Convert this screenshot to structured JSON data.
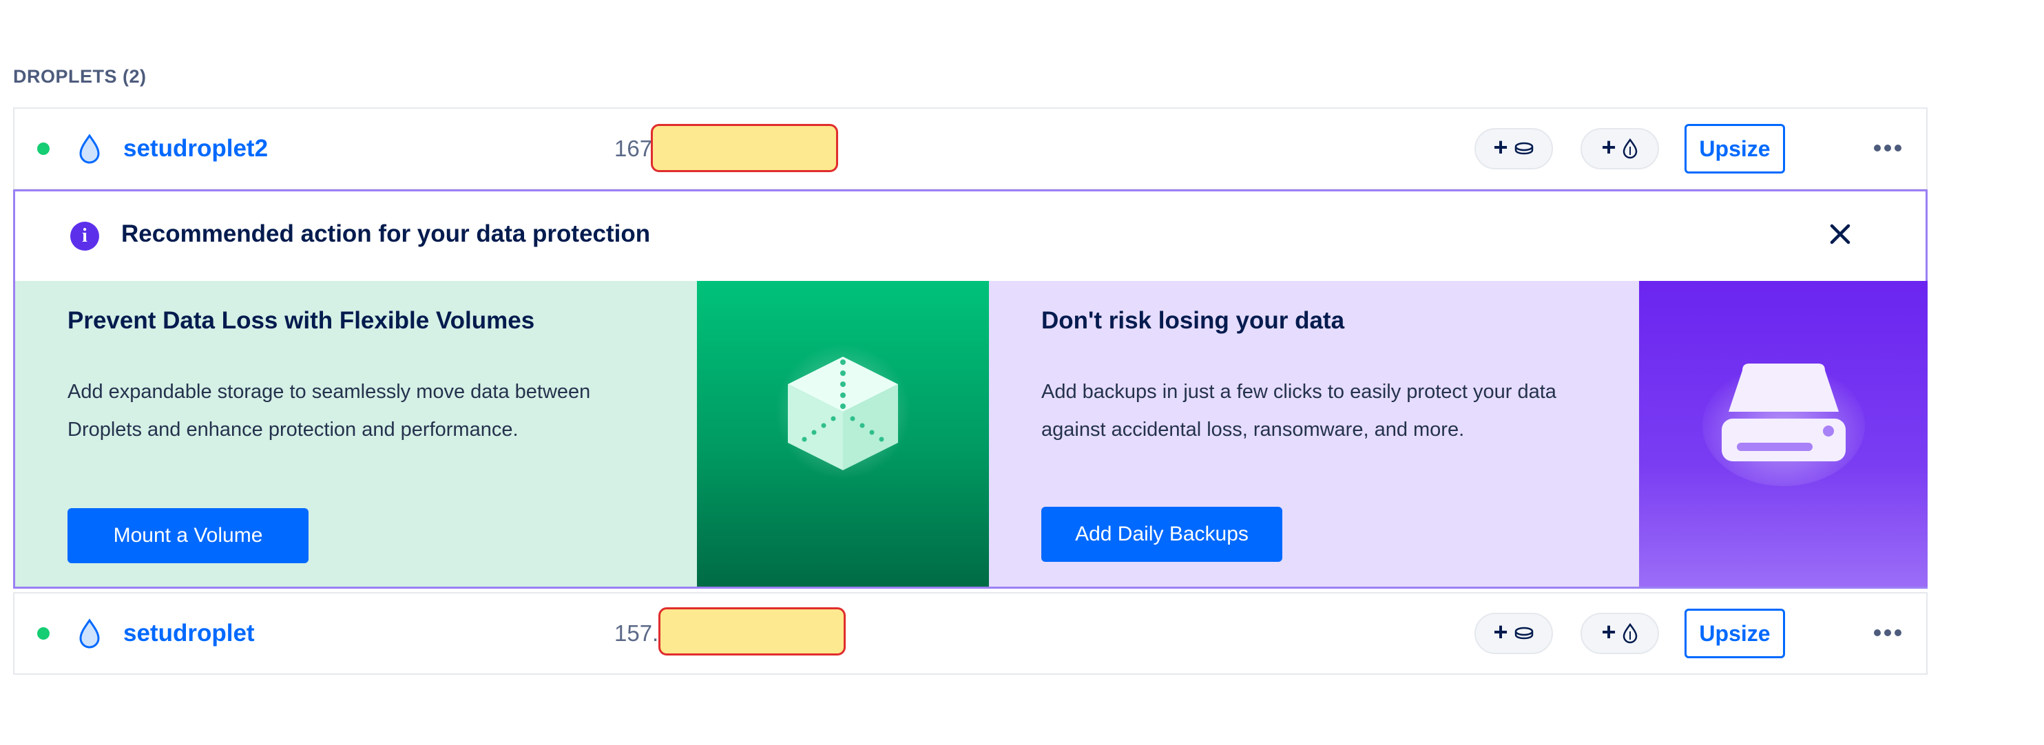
{
  "section": {
    "title": "DROPLETS (2)"
  },
  "droplets": [
    {
      "name": "setudroplet2",
      "ip": "167",
      "upsize_label": "Upsize",
      "status": "active"
    },
    {
      "name": "setudroplet",
      "ip": "157.",
      "upsize_label": "Upsize",
      "status": "active"
    }
  ],
  "pill_labels": {
    "plus": "+"
  },
  "recommendation": {
    "title": "Recommended action for your data protection",
    "info_glyph": "i",
    "volumes": {
      "title": "Prevent Data Loss with Flexible Volumes",
      "description": "Add expandable storage to seamlessly move data between Droplets and enhance protection and performance.",
      "cta": "Mount a Volume"
    },
    "backups": {
      "title": "Don't risk losing your data",
      "description": "Add backups in just a few clicks to easily protect your data against accidental loss, ransomware, and more.",
      "cta": "Add Daily Backups"
    }
  },
  "colors": {
    "brand_blue": "#0069ff",
    "status_green": "#15cd72",
    "accent_purple": "#5c30ea",
    "volume_panel": "#d5f0e5",
    "backup_panel": "#e6dcfd"
  },
  "icons": [
    "droplet-icon",
    "volume-icon",
    "backup-icon",
    "info-icon",
    "close-icon",
    "more-options-icon",
    "cube-icon",
    "drive-icon"
  ]
}
